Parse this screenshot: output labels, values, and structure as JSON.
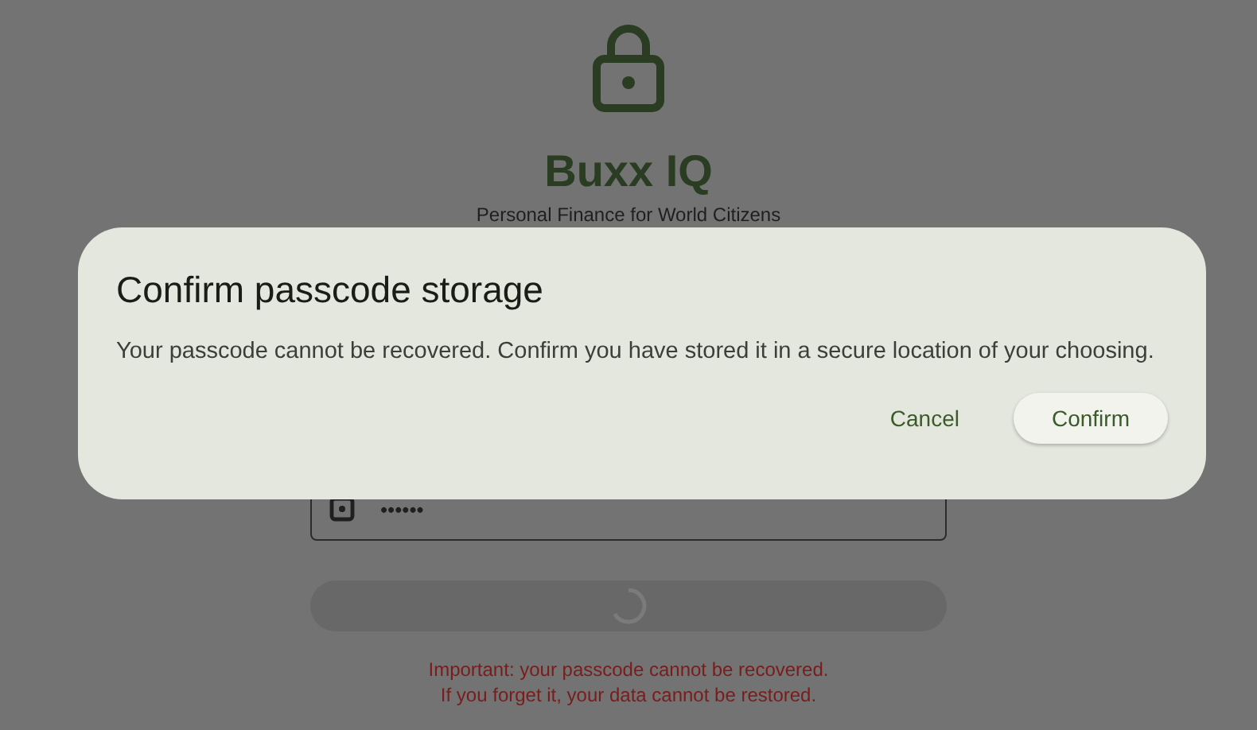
{
  "app": {
    "title": "Buxx IQ",
    "subtitle": "Personal Finance for World Citizens"
  },
  "passcode_field": {
    "value": "••••••"
  },
  "submit_button": {
    "loading": true
  },
  "warning": [
    "Important: your passcode cannot be recovered.",
    "If you forget it, your data cannot be restored."
  ],
  "dialog": {
    "title": "Confirm passcode storage",
    "message": "Your passcode cannot be recovered. Confirm you have stored it in a secure location of your choosing.",
    "buttons": [
      {
        "label": "Cancel",
        "kind": "text"
      },
      {
        "label": "Confirm",
        "kind": "tonal"
      }
    ]
  }
}
